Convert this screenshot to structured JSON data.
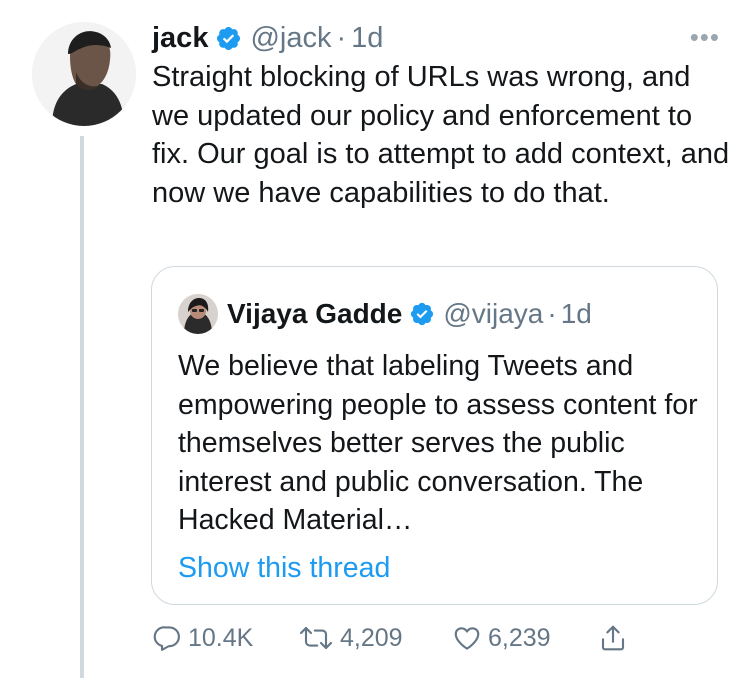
{
  "tweet": {
    "author_name": "jack",
    "handle": "@jack",
    "separator": "·",
    "time": "1d",
    "more_icon": "more-horizontal-icon",
    "text": "Straight blocking of URLs was wrong, and we updated our policy and enforcement to fix. Our goal is to attempt to add context, and now we have capabilities to do that."
  },
  "quote": {
    "author_name": "Vijaya Gadde",
    "handle": "@vijaya",
    "separator": "·",
    "time": "1d",
    "text": "We believe that labeling Tweets and empowering people to assess content for themselves better serves the public interest and public conversation. The Hacked Material…",
    "show_thread": "Show this thread"
  },
  "actions": {
    "replies": "10.4K",
    "retweets": "4,209",
    "likes": "6,239"
  },
  "colors": {
    "verified": "#1d9bf0",
    "link": "#1d9bf0",
    "secondary": "#657786",
    "border": "#cfd9de"
  }
}
